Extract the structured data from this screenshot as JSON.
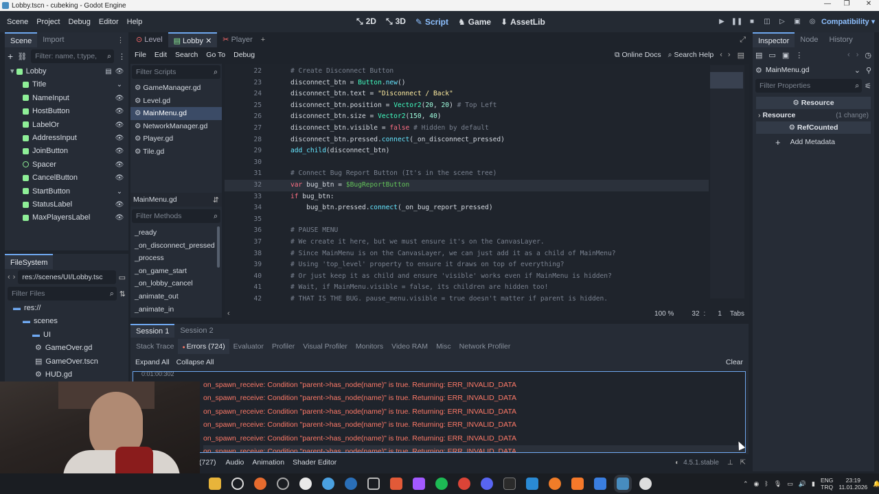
{
  "window": {
    "title": "Lobby.tscn - cubeking - Godot Engine"
  },
  "menubar": {
    "menus": [
      "Scene",
      "Project",
      "Debug",
      "Editor",
      "Help"
    ],
    "workspaces": [
      "2D",
      "3D",
      "Script",
      "Game",
      "AssetLib"
    ],
    "active_workspace": "Script",
    "renderer": "Compatibility"
  },
  "scene_dock": {
    "tabs": [
      "Scene",
      "Import"
    ],
    "filter_placeholder": "Filter: name, t:type,",
    "root": "Lobby",
    "nodes": [
      "Title",
      "NameInput",
      "HostButton",
      "LabelOr",
      "AddressInput",
      "JoinButton",
      "Spacer",
      "CancelButton",
      "StartButton",
      "StatusLabel",
      "MaxPlayersLabel"
    ]
  },
  "filesystem": {
    "title": "FileSystem",
    "path": "res://scenes/UI/Lobby.tsc",
    "filter_placeholder": "Filter Files",
    "items": [
      {
        "label": "res://",
        "icon": "folder"
      },
      {
        "label": "scenes",
        "icon": "folder"
      },
      {
        "label": "UI",
        "icon": "folder"
      },
      {
        "label": "GameOver.gd",
        "icon": "gear"
      },
      {
        "label": "GameOver.tscn",
        "icon": "scene"
      },
      {
        "label": "HUD.gd",
        "icon": "gear"
      }
    ]
  },
  "scene_tabs": [
    {
      "label": "Level"
    },
    {
      "label": "Lobby"
    },
    {
      "label": "Player"
    }
  ],
  "script_menu": [
    "File",
    "Edit",
    "Search",
    "Go To",
    "Debug"
  ],
  "script_toolbar": {
    "online_docs": "Online Docs",
    "search_help": "Search Help"
  },
  "script_list": {
    "filter_placeholder": "Filter Scripts",
    "scripts": [
      "GameManager.gd",
      "Level.gd",
      "MainMenu.gd",
      "NetworkManager.gd",
      "Player.gd",
      "Tile.gd"
    ],
    "selected": "MainMenu.gd",
    "current_script": "MainMenu.gd",
    "methods_placeholder": "Filter Methods",
    "methods": [
      "_ready",
      "_on_disconnect_pressed",
      "_process",
      "_on_game_start",
      "_on_lobby_cancel",
      "_animate_out",
      "_animate_in"
    ]
  },
  "code_lines": [
    {
      "n": "22",
      "text": "# Create Disconnect Button"
    },
    {
      "n": "23",
      "text": "disconnect_btn = Button.new()"
    },
    {
      "n": "24",
      "text": "disconnect_btn.text = \"Disconnect / Back\""
    },
    {
      "n": "25",
      "text": "disconnect_btn.position = Vector2(20, 20) # Top Left"
    },
    {
      "n": "26",
      "text": "disconnect_btn.size = Vector2(150, 40)"
    },
    {
      "n": "27",
      "text": "disconnect_btn.visible = false # Hidden by default"
    },
    {
      "n": "28",
      "text": "disconnect_btn.pressed.connect(_on_disconnect_pressed)"
    },
    {
      "n": "29",
      "text": "add_child(disconnect_btn)"
    },
    {
      "n": "30",
      "text": ""
    },
    {
      "n": "31",
      "text": "# Connect Bug Report Button (It's in the scene tree)"
    },
    {
      "n": "32",
      "text": "var bug_btn = $BugReportButton"
    },
    {
      "n": "33",
      "text": "if bug_btn:"
    },
    {
      "n": "34",
      "text": "    bug_btn.pressed.connect(_on_bug_report_pressed)"
    },
    {
      "n": "35",
      "text": ""
    },
    {
      "n": "36",
      "text": "# PAUSE MENU"
    },
    {
      "n": "37",
      "text": "# We create it here, but we must ensure it's on the CanvasLayer."
    },
    {
      "n": "38",
      "text": "# Since MainMenu is on the CanvasLayer, we can just add it as a child of MainMenu?"
    },
    {
      "n": "39",
      "text": "# Using 'top_level' property to ensure it draws on top of everything?"
    },
    {
      "n": "40",
      "text": "# Or just keep it as child and ensure 'visible' works even if MainMenu is hidden?"
    },
    {
      "n": "41",
      "text": "# Wait, if MainMenu.visible = false, its children are hidden too!"
    },
    {
      "n": "42",
      "text": "# THAT IS THE BUG. pause_menu.visible = true doesn't matter if parent is hidden."
    }
  ],
  "editor_status": {
    "zoom": "100 %",
    "line": "32",
    "col": "1",
    "indent": "Tabs"
  },
  "debugger": {
    "sessions": [
      "Session 1",
      "Session 2"
    ],
    "tabs": [
      "Stack Trace",
      "Errors (724)",
      "Evaluator",
      "Profiler",
      "Visual Profiler",
      "Monitors",
      "Video RAM",
      "Misc",
      "Network Profiler"
    ],
    "active_tab": "Errors (724)",
    "expand_all": "Expand All",
    "collapse_all": "Collapse All",
    "clear": "Clear",
    "partial_top": "0:01:00:302",
    "errors": [
      "on_spawn_receive: Condition \"parent->has_node(name)\" is true. Returning: ERR_INVALID_DATA",
      "on_spawn_receive: Condition \"parent->has_node(name)\" is true. Returning: ERR_INVALID_DATA",
      "on_spawn_receive: Condition \"parent->has_node(name)\" is true. Returning: ERR_INVALID_DATA",
      "on_spawn_receive: Condition \"parent->has_node(name)\" is true. Returning: ERR_INVALID_DATA",
      "on_spawn_receive: Condition \"parent->has_node(name)\" is true. Returning: ERR_INVALID_DATA",
      "on_spawn_receive: Condition \"parent->has_node(name)\" is true. Returning: ERR_INVALID_DATA"
    ]
  },
  "bottom_panel": {
    "count": "(727)",
    "tabs": [
      "Audio",
      "Animation",
      "Shader Editor"
    ],
    "version": "4.5.1.stable"
  },
  "inspector": {
    "tabs": [
      "Inspector",
      "Node",
      "History"
    ],
    "object": "MainMenu.gd",
    "filter_placeholder": "Filter Properties",
    "resource_header": "Resource",
    "resource_section": "Resource",
    "changes": "(1 change)",
    "refcounted": "RefCounted",
    "add_metadata": "Add Metadata"
  },
  "taskbar": {
    "lang": "ENG",
    "layout": "TRQ",
    "time": "23:19",
    "date": "11.01.2026"
  },
  "colors": {
    "accent": "#8ec0ff",
    "error": "#ff7a68",
    "bg": "#1e232b",
    "panel": "#262c36"
  }
}
